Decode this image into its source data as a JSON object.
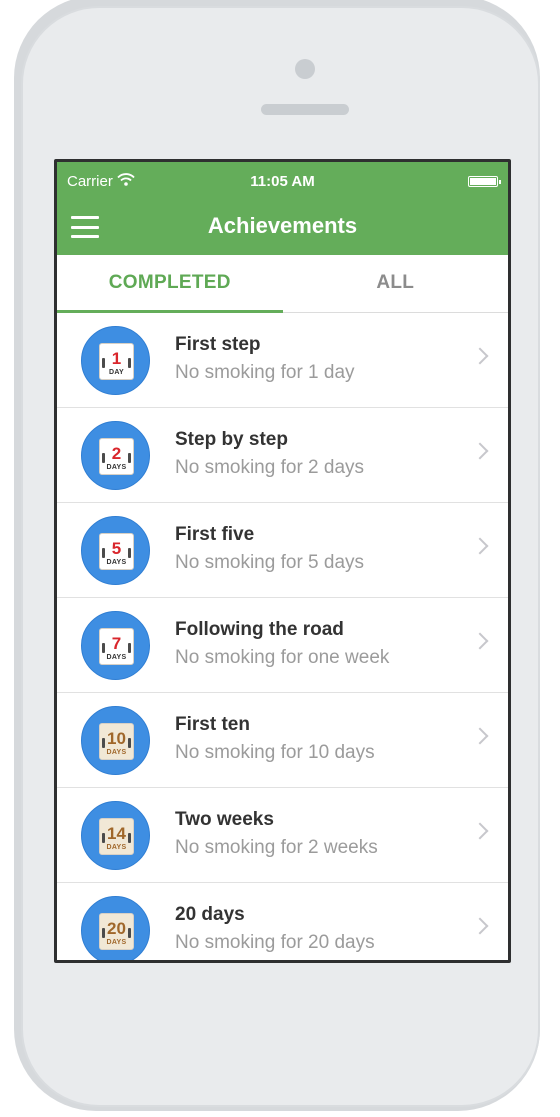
{
  "status_bar": {
    "carrier": "Carrier",
    "time": "11:05 AM"
  },
  "nav": {
    "title": "Achievements"
  },
  "tabs": [
    {
      "label": "COMPLETED",
      "active": true
    },
    {
      "label": "ALL",
      "active": false
    }
  ],
  "achievements": [
    {
      "number": "1",
      "unit": "DAY",
      "title": "First step",
      "subtitle": "No smoking for 1 day"
    },
    {
      "number": "2",
      "unit": "DAYS",
      "title": "Step by step",
      "subtitle": "No smoking for 2 days"
    },
    {
      "number": "5",
      "unit": "DAYS",
      "title": "First five",
      "subtitle": "No smoking for 5 days"
    },
    {
      "number": "7",
      "unit": "DAYS",
      "title": "Following the road",
      "subtitle": "No smoking for one week"
    },
    {
      "number": "10",
      "unit": "DAYS",
      "title": "First ten",
      "subtitle": "No smoking for 10 days"
    },
    {
      "number": "14",
      "unit": "DAYS",
      "title": "Two weeks",
      "subtitle": "No smoking for 2 weeks"
    },
    {
      "number": "20",
      "unit": "DAYS",
      "title": "20 days",
      "subtitle": "No smoking for 20 days"
    }
  ],
  "colors": {
    "brand_green": "#64ad5a",
    "badge_blue": "#3e8ee2",
    "calendar_red": "#d9262c",
    "calendar_brown": "#a0672a"
  }
}
